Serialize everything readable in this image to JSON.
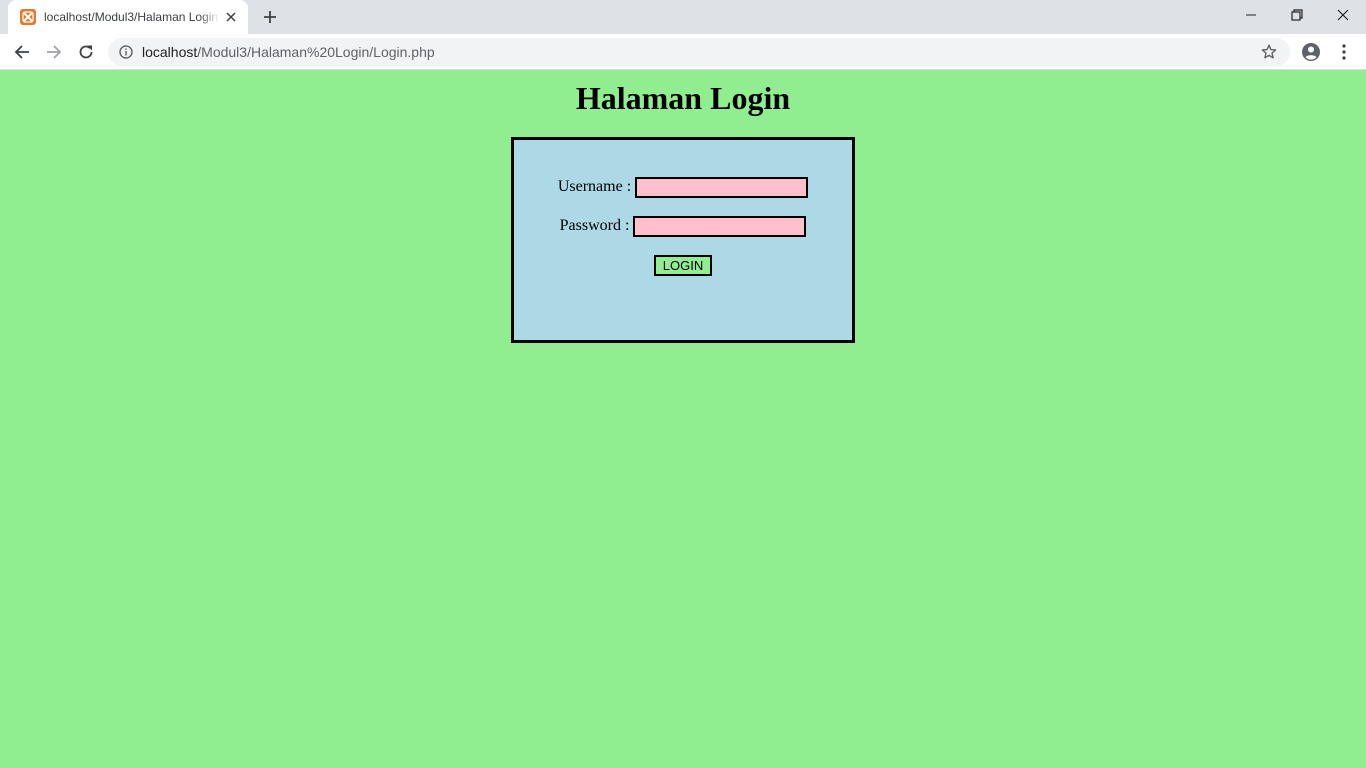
{
  "browser": {
    "tab": {
      "title": "localhost/Modul3/Halaman Login",
      "favicon": "xampp-icon"
    },
    "address_bar": {
      "host": "localhost",
      "path": "/Modul3/Halaman%20Login/Login.php"
    },
    "icons": {
      "back": "back-arrow-icon",
      "forward": "forward-arrow-icon",
      "reload": "reload-icon",
      "info": "info-icon",
      "bookmark": "star-icon",
      "profile": "account-icon",
      "menu": "kebab-menu-icon",
      "new_tab": "plus-icon",
      "minimize": "minimize-icon",
      "maximize": "restore-icon",
      "close": "close-icon"
    }
  },
  "page": {
    "title": "Halaman Login",
    "form": {
      "username_label": "Username :",
      "username_value": "",
      "password_label": "Password :",
      "password_value": "",
      "submit_label": "LOGIN"
    }
  },
  "colors": {
    "page_background": "#90ee90",
    "form_background": "#add8e6",
    "input_background": "#ffc0cb",
    "button_background": "#90ee90",
    "border": "#000000",
    "favicon": "#e8772e"
  }
}
